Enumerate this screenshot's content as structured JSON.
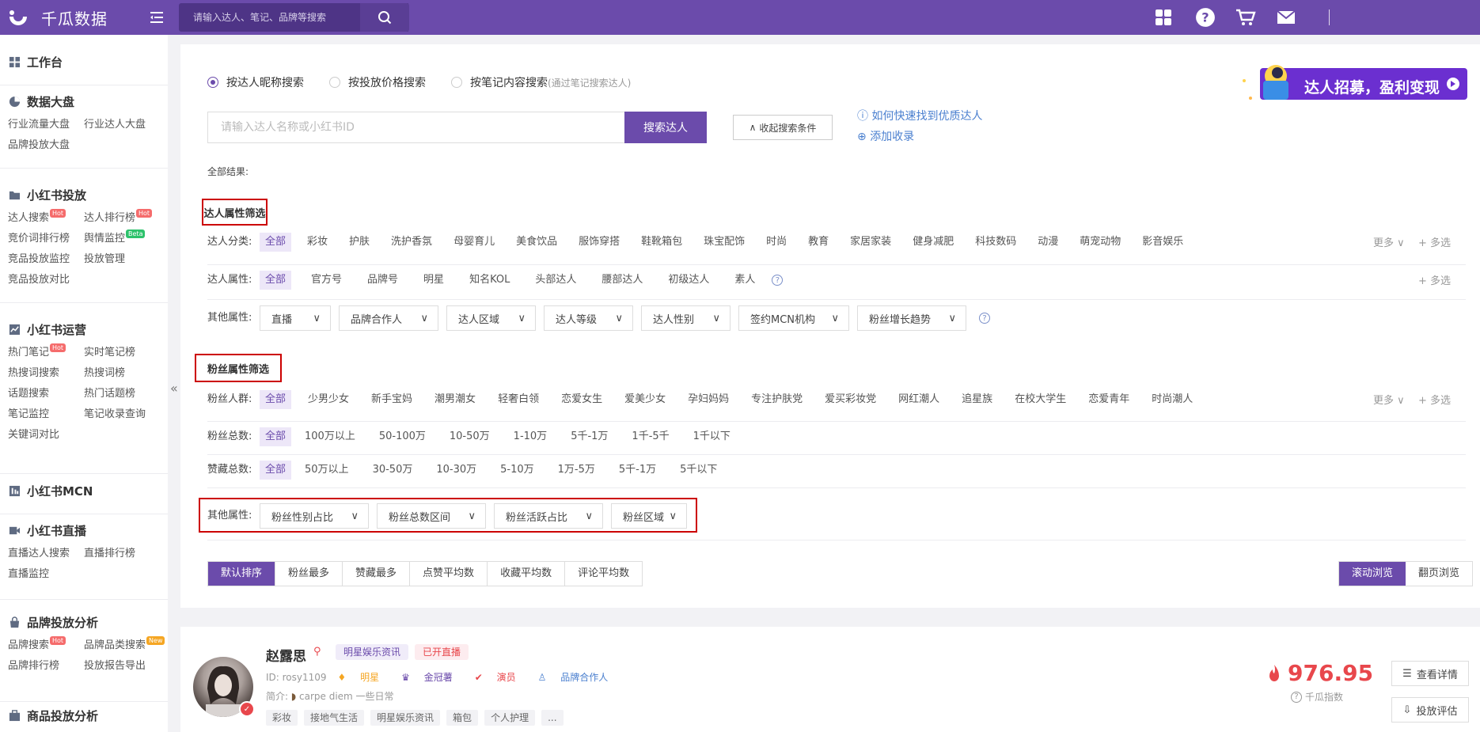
{
  "app": {
    "name": "千瓜数据",
    "search_placeholder": "请输入达人、笔记、品牌等搜索"
  },
  "sidebar": {
    "workbench": "工作台",
    "sections": [
      {
        "title": "数据大盘",
        "icon": "pie-chart-icon",
        "links": [
          {
            "label": "行业流量大盘"
          },
          {
            "label": "行业达人大盘"
          },
          {
            "label": "品牌投放大盘"
          }
        ]
      },
      {
        "title": "小红书投放",
        "icon": "folder-icon",
        "links": [
          {
            "label": "达人搜索",
            "badge": "Hot"
          },
          {
            "label": "达人排行榜",
            "badge": "Hot"
          },
          {
            "label": "竞价词排行榜"
          },
          {
            "label": "舆情监控",
            "badge": "Beta"
          },
          {
            "label": "竞品投放监控"
          },
          {
            "label": "投放管理"
          },
          {
            "label": "竞品投放对比"
          }
        ]
      },
      {
        "title": "小红书运营",
        "icon": "trend-chart-icon",
        "links": [
          {
            "label": "热门笔记",
            "badge": "Hot"
          },
          {
            "label": "实时笔记榜"
          },
          {
            "label": "热搜词搜索"
          },
          {
            "label": "热搜词榜"
          },
          {
            "label": "话题搜索"
          },
          {
            "label": "热门话题榜"
          },
          {
            "label": "笔记监控"
          },
          {
            "label": "笔记收录查询"
          },
          {
            "label": "关键词对比"
          }
        ]
      },
      {
        "title": "小红书MCN",
        "icon": "mcn-icon",
        "links": []
      },
      {
        "title": "小红书直播",
        "icon": "video-icon",
        "links": [
          {
            "label": "直播达人搜索"
          },
          {
            "label": "直播排行榜"
          },
          {
            "label": "直播监控"
          }
        ]
      },
      {
        "title": "品牌投放分析",
        "icon": "bag-icon",
        "links": [
          {
            "label": "品牌搜索",
            "badge": "Hot"
          },
          {
            "label": "品牌品类搜索",
            "badge": "New"
          },
          {
            "label": "品牌排行榜"
          },
          {
            "label": "投放报告导出"
          }
        ]
      },
      {
        "title": "商品投放分析",
        "icon": "cart-icon",
        "links": []
      }
    ],
    "collapse": "«"
  },
  "search": {
    "modes": [
      {
        "label": "按达人昵称搜索",
        "selected": true
      },
      {
        "label": "按投放价格搜索",
        "selected": false
      },
      {
        "label": "按笔记内容搜索",
        "sub": "(通过笔记搜索达人)",
        "selected": false
      }
    ],
    "placeholder": "请输入达人名称或小红书ID",
    "button": "搜索达人",
    "collapse_btn": "收起搜索条件",
    "help_link": "如何快速找到优质达人",
    "add_link": "添加收录",
    "banner": "达人招募，盈利变现",
    "result_label": "全部结果:"
  },
  "influencer_filters": {
    "title": "达人属性筛选",
    "category": {
      "label": "达人分类:",
      "options": [
        "全部",
        "彩妆",
        "护肤",
        "洗护香氛",
        "母婴育儿",
        "美食饮品",
        "服饰穿搭",
        "鞋靴箱包",
        "珠宝配饰",
        "时尚",
        "教育",
        "家居家装",
        "健身减肥",
        "科技数码",
        "动漫",
        "萌宠动物",
        "影音娱乐"
      ]
    },
    "attribute": {
      "label": "达人属性:",
      "options": [
        "全部",
        "官方号",
        "品牌号",
        "明星",
        "知名KOL",
        "头部达人",
        "腰部达人",
        "初级达人",
        "素人"
      ]
    },
    "other": {
      "label": "其他属性:",
      "dropdowns": [
        "直播",
        "品牌合作人",
        "达人区域",
        "达人等级",
        "达人性别",
        "签约MCN机构",
        "粉丝增长趋势"
      ]
    },
    "more": "更多",
    "multi": "+ 多选"
  },
  "fan_filters": {
    "title": "粉丝属性筛选",
    "crowd": {
      "label": "粉丝人群:",
      "options": [
        "全部",
        "少男少女",
        "新手宝妈",
        "潮男潮女",
        "轻奢白领",
        "恋爱女生",
        "爱美少女",
        "孕妇妈妈",
        "专注护肤党",
        "爱买彩妆党",
        "网红潮人",
        "追星族",
        "在校大学生",
        "恋爱青年",
        "时尚潮人"
      ]
    },
    "total": {
      "label": "粉丝总数:",
      "options": [
        "全部",
        "100万以上",
        "50-100万",
        "10-50万",
        "1-10万",
        "5千-1万",
        "1千-5千",
        "1千以下"
      ]
    },
    "likes": {
      "label": "赞藏总数:",
      "options": [
        "全部",
        "50万以上",
        "30-50万",
        "10-30万",
        "5-10万",
        "1万-5万",
        "5千-1万",
        "5千以下"
      ]
    },
    "other": {
      "label": "其他属性:",
      "dropdowns": [
        "粉丝性别占比",
        "粉丝总数区间",
        "粉丝活跃占比",
        "粉丝区域"
      ]
    }
  },
  "sort": {
    "tabs": [
      "默认排序",
      "粉丝最多",
      "赞藏最多",
      "点赞平均数",
      "收藏平均数",
      "评论平均数"
    ],
    "views": [
      "滚动浏览",
      "翻页浏览"
    ]
  },
  "result": {
    "name": "赵露思",
    "category_pill": "明星娱乐资讯",
    "live_pill": "已开直播",
    "id": "ID: rosy1109",
    "badges": [
      "明星",
      "金冠薯",
      "演员",
      "品牌合作人"
    ],
    "intro_label": "简介:",
    "intro": "carpe diem 一些日常",
    "tags": [
      "彩妆",
      "接地气生活",
      "明星娱乐资讯",
      "箱包",
      "个人护理",
      "..."
    ],
    "score": "976.95",
    "score_label": "千瓜指数",
    "detail_btn": "查看详情",
    "eval_btn": "投放评估"
  },
  "colors": {
    "brand": "#6b4bab",
    "highlight_box": "#cc0000",
    "score": "#e8474c"
  }
}
